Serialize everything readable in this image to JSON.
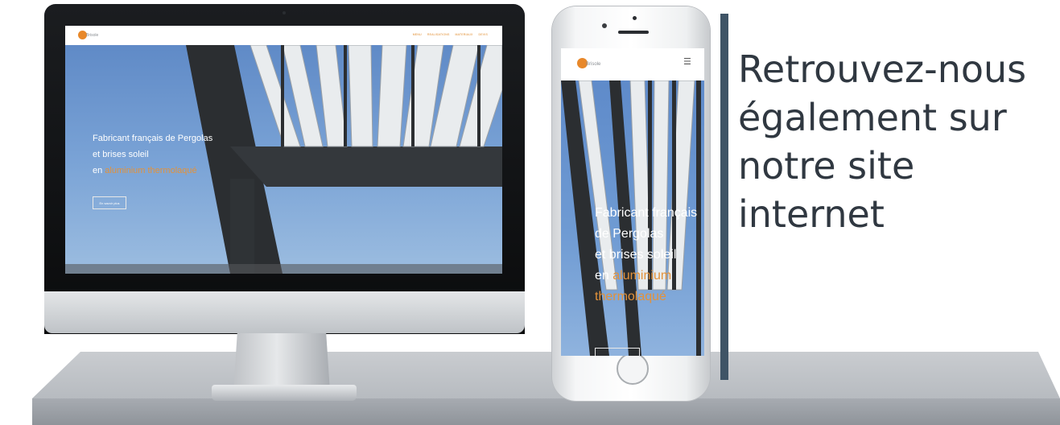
{
  "desktop_site": {
    "brand": "Brisole",
    "nav_items": [
      "MENU",
      "REALISATIONS",
      "MATERIAUX",
      "DEVIS"
    ],
    "hero_lines": [
      "Fabricant français de Pergolas",
      "et brises soleil"
    ],
    "hero_prefix": "en ",
    "hero_accent": "aluminium thermolaqué",
    "cta_label": "En savoir plus"
  },
  "mobile_site": {
    "brand": "Brisole",
    "menu_icon": "hamburger-icon",
    "hero_lines": [
      "Fabricant français",
      "de Pergolas",
      "et brises soleil"
    ],
    "hero_prefix": "en ",
    "hero_accent_1": "aluminium",
    "hero_accent_2": "thermolaqué"
  },
  "headline": {
    "lines": [
      "Retrouvez-nous",
      "également sur",
      "notre site",
      "internet"
    ]
  },
  "colors": {
    "accent": "#e8882a",
    "divider": "#3f5466",
    "headline": "#303841",
    "sky": "#6f9bd3"
  }
}
